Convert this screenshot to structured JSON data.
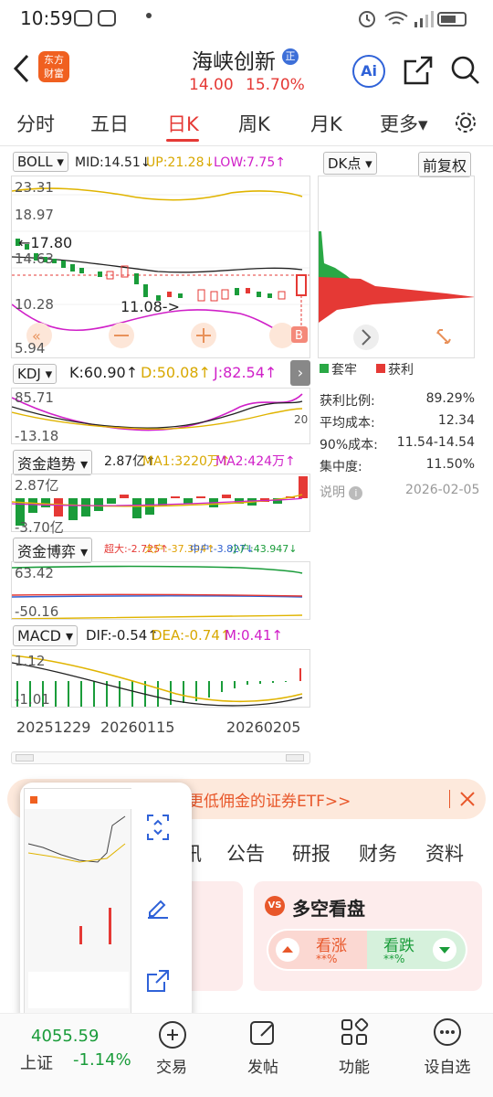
{
  "status": {
    "time": "10:59"
  },
  "header": {
    "title": "海峡创新",
    "badge": "正",
    "price": "14.00",
    "change_pct": "15.70%",
    "ai_label": "Ai",
    "logo_line1": "东方",
    "logo_line2": "财富"
  },
  "tabs": [
    "分时",
    "五日",
    "日K",
    "周K",
    "月K",
    "更多▾"
  ],
  "boll": {
    "select": "BOLL ▾",
    "mid": "MID:14.51↓",
    "up": "UP:21.28↓",
    "low": "LOW:7.75↑",
    "y": [
      "23.31",
      "18.97",
      "14.63",
      "10.28",
      "5.94"
    ],
    "ann_high": "←17.80",
    "ann_low": "11.08->"
  },
  "dk": {
    "select": "DK点 ▾",
    "fq": "前复权",
    "legend_lock": "套牢",
    "legend_profit": "获利",
    "rows": [
      {
        "k": "获利比例:",
        "v": "89.29%"
      },
      {
        "k": "平均成本:",
        "v": "12.34"
      },
      {
        "k": "90%成本:",
        "v": "11.54-14.54"
      },
      {
        "k": "集中度:",
        "v": "11.50%"
      }
    ],
    "note": "说明",
    "date": "2026-02-05"
  },
  "kdj": {
    "select": "KDJ ▾",
    "k": "K:60.90↑",
    "d": "D:50.08↑",
    "j": "J:82.54↑",
    "y_top": "85.71",
    "y_bot": "-13.18",
    "y_right": "20"
  },
  "flow": {
    "select": "资金趋势 ▾",
    "v": "2.87亿↑",
    "ma1": "MA1:3220万↑",
    "ma2": "MA2:424万↑",
    "y_top": "2.87亿",
    "y_bot": "-3.70亿"
  },
  "game": {
    "select": "资金博弈 ▾",
    "big": "超大:-2.725↑",
    "large": "大户:-37.394↑",
    "mid": "中户:-3.827↓",
    "small": "小户:43.947↓",
    "y_top": "63.42",
    "y_bot": "-50.16"
  },
  "macd": {
    "select": "MACD ▾",
    "dif": "DIF:-0.54↑",
    "dea": "DEA:-0.74↑",
    "m": "M:0.41↑",
    "y_top": "1.12",
    "y_bot": "-1.01"
  },
  "dates": [
    "20251229",
    "20260115",
    "20260205"
  ],
  "banner": {
    "text": "更低佣金的证券ETF>>"
  },
  "info_tabs": [
    "讯",
    "公告",
    "研报",
    "财务",
    "资料"
  ],
  "vote": {
    "title": "多空看盘",
    "up": "看涨",
    "down": "看跌",
    "up_pct": "**%",
    "down_pct": "**%"
  },
  "index": {
    "value": "4055.59",
    "name": "上证",
    "pct": "-1.14%"
  },
  "dock": [
    "交易",
    "发帖",
    "功能",
    "设自选"
  ],
  "colors": {
    "red": "#e53935",
    "green": "#1a9c3a",
    "gold": "#e0b400",
    "magenta": "#d020c8"
  }
}
